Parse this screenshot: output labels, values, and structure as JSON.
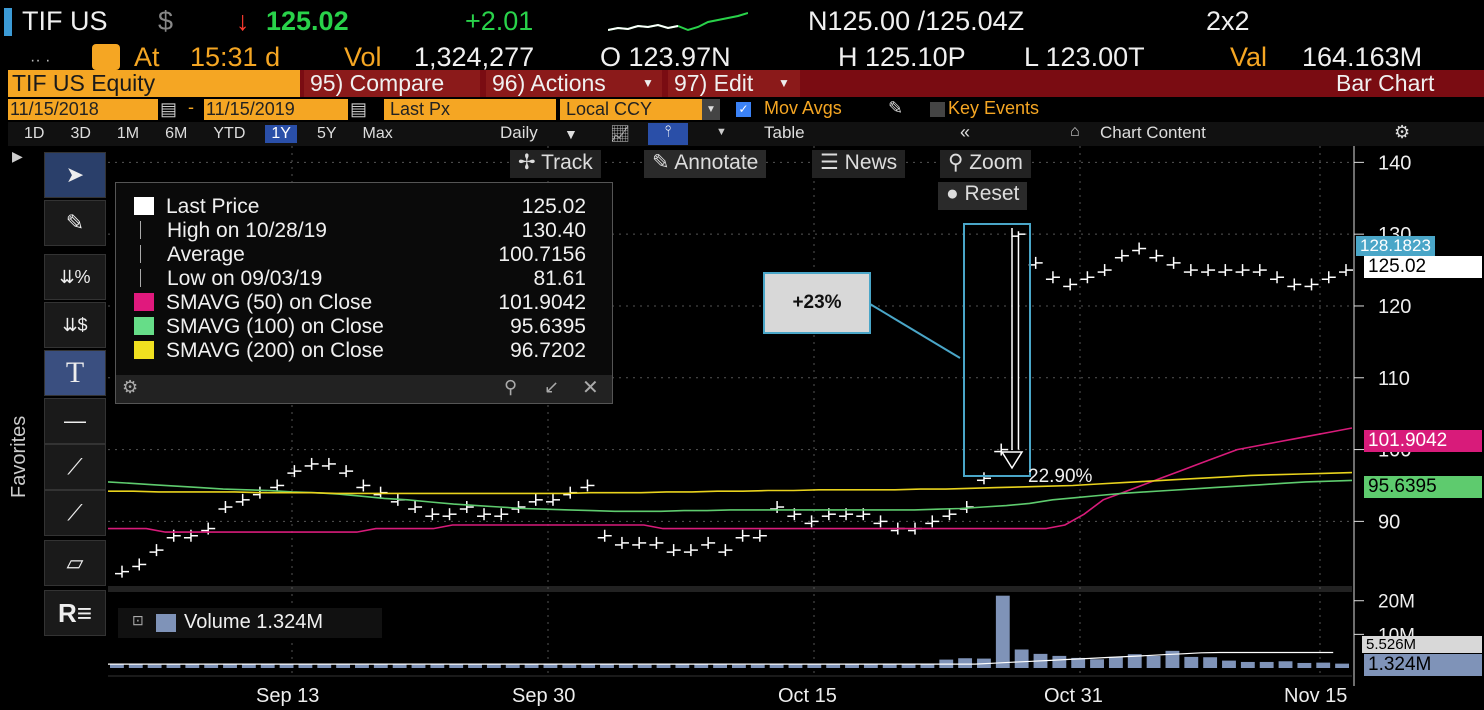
{
  "header": {
    "ticker": "TIF US",
    "currency_symbol": "$",
    "arrow": "↓",
    "last": "125.02",
    "change": "+2.01",
    "bid_ask": "N125.00 /125.04Z",
    "size": "2x2",
    "at_label": "At",
    "time": "15:31 d",
    "vol_label": "Vol",
    "volume": "1,324,277",
    "open": "O 123.97N",
    "high": "H 125.10P",
    "low": "L 123.00T",
    "val_label": "Val",
    "val": "164.163M"
  },
  "menu": {
    "security": "TIF US Equity",
    "compare": "95) Compare",
    "actions": "96) Actions",
    "edit": "97) Edit",
    "view": "Bar Chart"
  },
  "settings": {
    "start_date": "11/15/2018",
    "end_date": "11/15/2019",
    "field": "Last Px",
    "currency": "Local CCY",
    "mov_avgs": "Mov Avgs",
    "key_events": "Key Events"
  },
  "timeframes": [
    "1D",
    "3D",
    "1M",
    "6M",
    "YTD",
    "1Y",
    "5Y",
    "Max"
  ],
  "timeframe_selected": "1Y",
  "period": "Daily",
  "table_label": "Table",
  "chart_content_label": "Chart Content",
  "chart_tools": {
    "track": "Track",
    "annotate": "Annotate",
    "news": "News",
    "zoom": "Zoom",
    "reset": "Reset"
  },
  "sidebar": {
    "favorites": "Favorites"
  },
  "legend": {
    "rows": [
      {
        "label": "Last Price",
        "value": "125.02",
        "color": "#ffffff"
      },
      {
        "label": "High on 10/28/19",
        "value": "130.40",
        "color": ""
      },
      {
        "label": "Average",
        "value": "100.7156",
        "color": ""
      },
      {
        "label": "Low on 09/03/19",
        "value": "81.61",
        "color": ""
      },
      {
        "label": "SMAVG (50)  on Close",
        "value": "101.9042",
        "color": "#e0197d"
      },
      {
        "label": "SMAVG (100)  on Close",
        "value": "95.6395",
        "color": "#66dd88"
      },
      {
        "label": "SMAVG (200)  on Close",
        "value": "96.7202",
        "color": "#f0e020"
      }
    ]
  },
  "annotation": {
    "box_text": "+23%",
    "pct_label": "22.90%"
  },
  "price_tags": {
    "high_tag": "128.1823",
    "last_tag": "125.02",
    "sma50_tag": "101.9042",
    "sma100_tag": "95.6395"
  },
  "volume_legend": "Volume  1.324M",
  "volume_tags": {
    "vol_tag": "1.324M",
    "vol_tag2": "5.526M"
  },
  "colors": {
    "sma50": "#d81b7a",
    "sma100": "#5ecb6e",
    "sma200": "#e8d21d",
    "price": "#ffffff",
    "volume": "#7f93b8"
  },
  "chart_data": [
    {
      "type": "bar",
      "title": "",
      "x_tick_labels": [
        "Sep 13",
        "Sep 30",
        "Oct 15",
        "Oct 31",
        "Nov 15"
      ],
      "y_tick_labels": [
        "90",
        "100",
        "110",
        "120",
        "130",
        "140"
      ],
      "ylim": [
        81,
        142
      ],
      "series": [
        {
          "name": "Last Price",
          "values": [
            83,
            84,
            86,
            88,
            88,
            89,
            92,
            93,
            94,
            95,
            97,
            98,
            98,
            97,
            95,
            94,
            93,
            92,
            91,
            91,
            92,
            91,
            91,
            92,
            93,
            93,
            94,
            95,
            88,
            87,
            87,
            87,
            86,
            86,
            87,
            86,
            88,
            88,
            92,
            91,
            90,
            91,
            91,
            91,
            90,
            89,
            89,
            90,
            91,
            92,
            96,
            100,
            130,
            126,
            124,
            123,
            124,
            125,
            127,
            128,
            127,
            126,
            125,
            125,
            125,
            125,
            125,
            124,
            123,
            123,
            124,
            125
          ]
        },
        {
          "name": "SMAVG (50)",
          "values": [
            89,
            89,
            89,
            88.5,
            88.5,
            88.5,
            88.5,
            88.5,
            88.5,
            88.5,
            88.5,
            88.5,
            88.5,
            88.5,
            89,
            89,
            89,
            89,
            89.5,
            89.5,
            89.5,
            89.5,
            89.5,
            89.5,
            89.5,
            89.5,
            89.5,
            89.5,
            89.5,
            89,
            89,
            89,
            89,
            89,
            89,
            89,
            89,
            89,
            89,
            89,
            89,
            89,
            89,
            89,
            89,
            89,
            89,
            89,
            89,
            89,
            89.5,
            91,
            93,
            94,
            95,
            96,
            97,
            98,
            99,
            100,
            100.5,
            101,
            101.5,
            102,
            102.5,
            103
          ]
        },
        {
          "name": "SMAVG (100)",
          "values": [
            95.5,
            95.3,
            95.1,
            94.9,
            94.7,
            94.5,
            94.4,
            94.3,
            94.1,
            94,
            93.8,
            93.5,
            93.2,
            93,
            92.7,
            92.4,
            92.2,
            92,
            91.8,
            91.7,
            91.6,
            91.5,
            91.4,
            91.4,
            91.4,
            91.5,
            91.5,
            91.6,
            91.6,
            91.6,
            91.6,
            91.6,
            91.6,
            91.6,
            91.6,
            91.6,
            91.7,
            91.8,
            92,
            92.2,
            92.5,
            93,
            93.3,
            93.6,
            93.9,
            94.1,
            94.3,
            94.5,
            94.7,
            94.9,
            95.1,
            95.3,
            95.5,
            95.6,
            95.7
          ]
        },
        {
          "name": "SMAVG (200)",
          "values": [
            94.2,
            94.2,
            94.1,
            94.1,
            94.1,
            94.1,
            94,
            94,
            94,
            93.9,
            93.9,
            93.9,
            93.9,
            93.9,
            93.9,
            93.9,
            93.9,
            93.9,
            93.9,
            94,
            94,
            94,
            94.1,
            94.1,
            94.2,
            94.2,
            94.3,
            94.3,
            94.4,
            94.4,
            94.4,
            94.4,
            94.5,
            94.5,
            94.6,
            94.7,
            94.8,
            94.9,
            95,
            95.2,
            95.4,
            95.6,
            95.8,
            96,
            96.2,
            96.4,
            96.5,
            96.6,
            96.7,
            96.8
          ]
        }
      ],
      "grid": true,
      "legend": "top-left"
    },
    {
      "type": "bar",
      "title": "",
      "y_tick_labels": [
        "10M",
        "20M"
      ],
      "ylim": [
        0,
        22
      ],
      "series": [
        {
          "name": "Volume",
          "values": [
            1.2,
            1.1,
            1.0,
            1.3,
            1.2,
            1.0,
            1.1,
            1.3,
            1.2,
            1.1,
            1.3,
            1.2,
            1.1,
            1.0,
            1.2,
            1.1,
            1.0,
            1.1,
            1.2,
            1.3,
            1.1,
            1.0,
            1.1,
            1.2,
            1.0,
            1.1,
            1.2,
            1.1,
            1.0,
            1.1,
            1.2,
            1.3,
            1.1,
            1.0,
            1.0,
            1.1,
            1.2,
            1.3,
            1.2,
            1.2,
            1.1,
            1.3,
            1.2,
            1.1,
            2.5,
            2.9,
            2.8,
            21.5,
            5.5,
            4.2,
            3.6,
            3.0,
            2.6,
            3.3,
            4.1,
            3.6,
            5.1,
            3.3,
            3.2,
            2.2,
            1.8,
            1.8,
            2.0,
            1.5,
            1.6,
            1.3
          ]
        }
      ],
      "grid": false
    }
  ]
}
